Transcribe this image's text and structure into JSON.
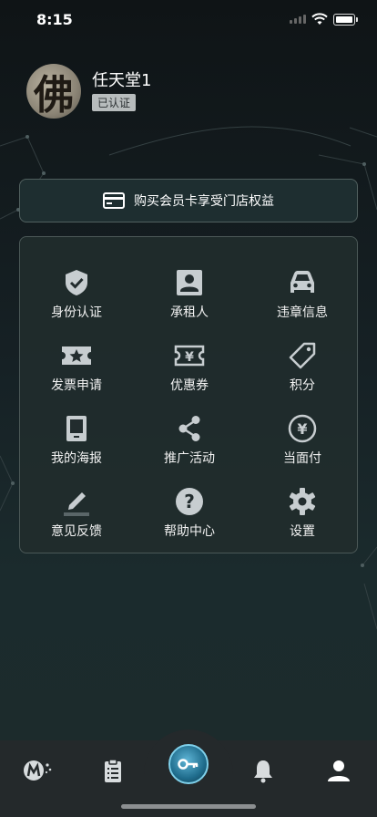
{
  "status_bar": {
    "time": "8:15"
  },
  "profile": {
    "name": "任天堂1",
    "verified_badge": "已认证",
    "avatar_char": "佛"
  },
  "membership": {
    "label": "购买会员卡享受门店权益",
    "icon": "credit-card-icon"
  },
  "grid": [
    {
      "label": "身份认证",
      "icon": "shield-check-icon"
    },
    {
      "label": "承租人",
      "icon": "person-card-icon"
    },
    {
      "label": "违章信息",
      "icon": "car-icon"
    },
    {
      "label": "发票申请",
      "icon": "ticket-star-icon"
    },
    {
      "label": "优惠券",
      "icon": "coupon-yen-icon"
    },
    {
      "label": "积分",
      "icon": "tag-icon"
    },
    {
      "label": "我的海报",
      "icon": "tablet-icon"
    },
    {
      "label": "推广活动",
      "icon": "share-icon"
    },
    {
      "label": "当面付",
      "icon": "yen-circle-icon"
    },
    {
      "label": "意见反馈",
      "icon": "pencil-icon"
    },
    {
      "label": "帮助中心",
      "icon": "help-circle-icon"
    },
    {
      "label": "设置",
      "icon": "gear-icon"
    }
  ],
  "tabbar": [
    {
      "icon": "brand-logo-icon"
    },
    {
      "icon": "clipboard-list-icon"
    },
    {
      "icon": "key-icon"
    },
    {
      "icon": "bell-icon"
    },
    {
      "icon": "user-icon"
    }
  ],
  "colors": {
    "icon_gray": "#c7cdd0",
    "panel_border": "#4b5857",
    "accent_blue": "#2d8fb5"
  }
}
